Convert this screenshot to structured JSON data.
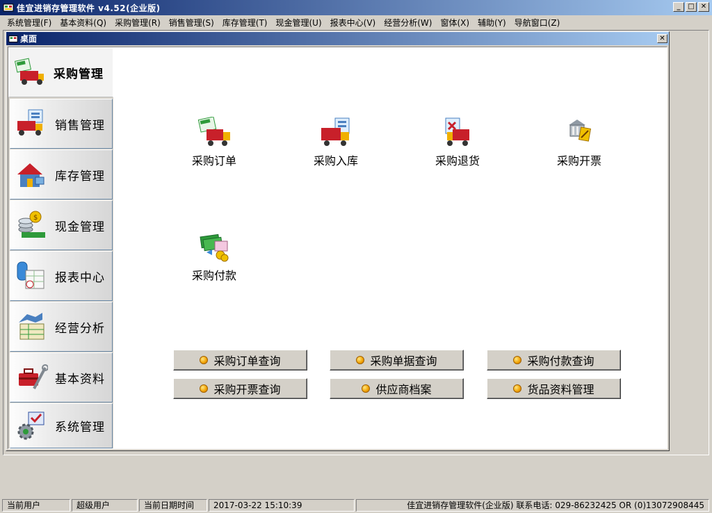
{
  "window": {
    "title": "佳宜进销存管理软件 v4.52(企业版)"
  },
  "menu": [
    "系统管理(F)",
    "基本资料(Q)",
    "采购管理(R)",
    "销售管理(S)",
    "库存管理(T)",
    "现金管理(U)",
    "报表中心(V)",
    "经营分析(W)",
    "窗体(X)",
    "辅助(Y)",
    "导航窗口(Z)"
  ],
  "desktop": {
    "title": "桌面",
    "nav": [
      {
        "label": "采购管理",
        "icon": "truck-order-icon",
        "active": true
      },
      {
        "label": "销售管理",
        "icon": "truck-sales-icon"
      },
      {
        "label": "库存管理",
        "icon": "house-icon"
      },
      {
        "label": "现金管理",
        "icon": "coins-icon"
      },
      {
        "label": "报表中心",
        "icon": "report-icon"
      },
      {
        "label": "经营分析",
        "icon": "analysis-icon"
      },
      {
        "label": "基本资料",
        "icon": "toolbox-icon"
      },
      {
        "label": "系统管理",
        "icon": "gear-icon"
      }
    ],
    "functions": [
      {
        "label": "采购订单",
        "icon": "purchase-order-icon"
      },
      {
        "label": "采购入库",
        "icon": "purchase-stockin-icon"
      },
      {
        "label": "采购退货",
        "icon": "purchase-return-icon"
      },
      {
        "label": "采购开票",
        "icon": "purchase-invoice-icon"
      },
      {
        "label": "采购付款",
        "icon": "purchase-payment-icon"
      }
    ],
    "quick_buttons": [
      "采购订单查询",
      "采购单据查询",
      "采购付款查询",
      "采购开票查询",
      "供应商档案",
      "货品资料管理"
    ]
  },
  "status": {
    "user_label": "当前用户",
    "user_value": "超级用户",
    "datetime_label": "当前日期时间",
    "datetime_value": "2017-03-22 15:10:39",
    "info": "佳宜进销存管理软件(企业版) 联系电话: 029-86232425 OR (0)13072908445"
  },
  "colors": {
    "titlebar": "#0a246a",
    "face": "#d4d0c8",
    "accent_red": "#c8202a",
    "accent_green": "#2e9a3a"
  }
}
